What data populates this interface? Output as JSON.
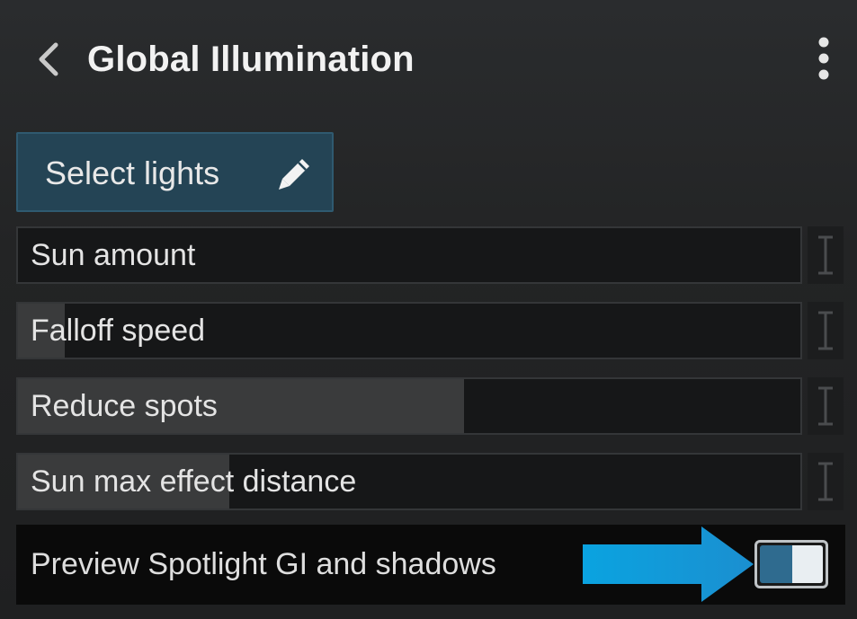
{
  "header": {
    "title": "Global Illumination",
    "back_icon": "chevron-left-icon",
    "more_icon": "vertical-ellipsis-icon"
  },
  "select_lights": {
    "label": "Select lights",
    "icon": "pencil-icon"
  },
  "sliders": [
    {
      "label": "Sun amount",
      "fill_fraction": 0.0
    },
    {
      "label": "Falloff speed",
      "fill_fraction": 0.06
    },
    {
      "label": "Reduce spots",
      "fill_fraction": 0.57
    },
    {
      "label": "Sun max effect distance",
      "fill_fraction": 0.27
    }
  ],
  "toggle": {
    "label": "Preview Spotlight GI and shadows",
    "state": "on",
    "pointer_icon": "blue-arrow-icon"
  },
  "colors": {
    "accent": "#2f6b8f",
    "arrow": "#0a9ad8",
    "button_bg": "#244455"
  }
}
